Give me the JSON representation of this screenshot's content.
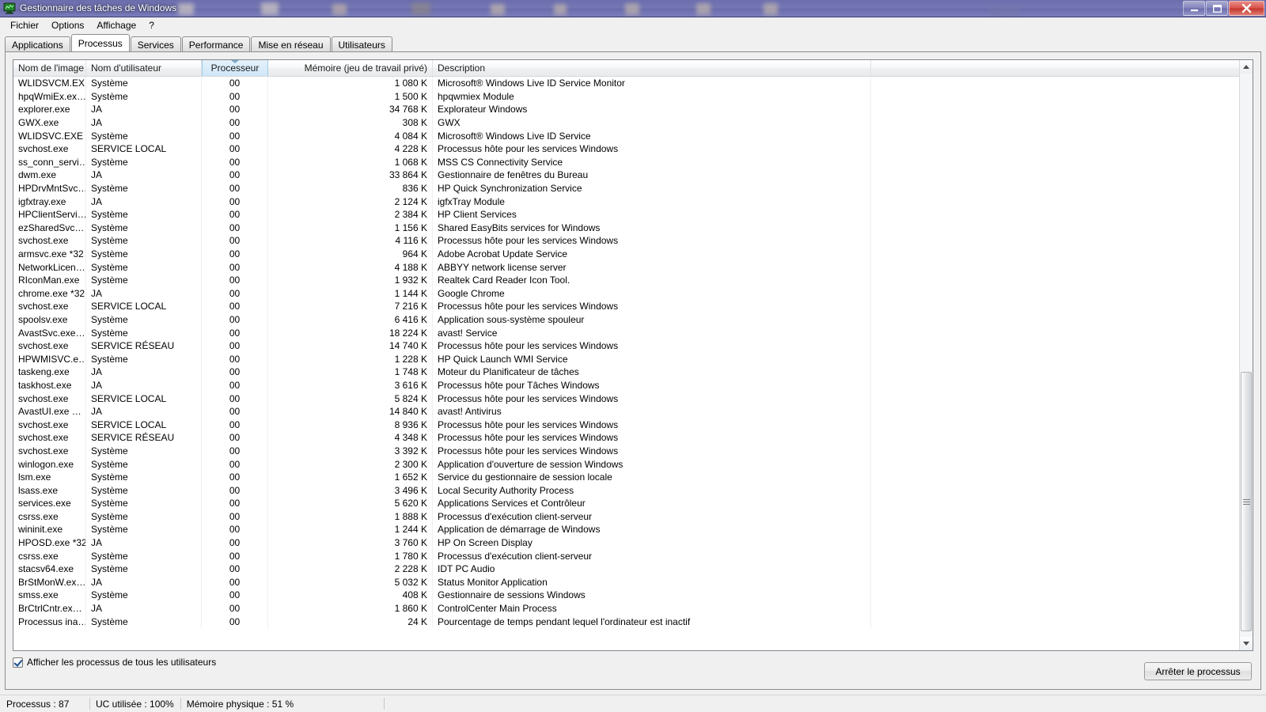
{
  "window": {
    "title": "Gestionnaire des tâches de Windows",
    "icon": "task-manager-icon",
    "controls": {
      "minimize": "—",
      "maximize": "❐",
      "close": "✕"
    }
  },
  "menu": {
    "items": [
      {
        "label": "Fichier"
      },
      {
        "label": "Options"
      },
      {
        "label": "Affichage"
      },
      {
        "label": "?"
      }
    ]
  },
  "tabs": [
    {
      "label": "Applications",
      "active": false
    },
    {
      "label": "Processus",
      "active": true
    },
    {
      "label": "Services",
      "active": false
    },
    {
      "label": "Performance",
      "active": false
    },
    {
      "label": "Mise en réseau",
      "active": false
    },
    {
      "label": "Utilisateurs",
      "active": false
    }
  ],
  "table": {
    "sorted_column": "Processeur",
    "sort_direction": "descending",
    "columns": [
      {
        "key": "name",
        "label": "Nom de l'image",
        "align": "left"
      },
      {
        "key": "user",
        "label": "Nom d'utilisateur",
        "align": "left"
      },
      {
        "key": "cpu",
        "label": "Processeur",
        "align": "center"
      },
      {
        "key": "mem",
        "label": "Mémoire (jeu de travail privé)",
        "align": "right"
      },
      {
        "key": "desc",
        "label": "Description",
        "align": "left"
      }
    ],
    "rows": [
      {
        "name": "WLIDSVCM.EXE",
        "user": "Système",
        "cpu": "00",
        "mem": "1 080 K",
        "desc": "Microsoft® Windows Live ID Service Monitor"
      },
      {
        "name": "hpqWmiEx.ex…",
        "user": "Système",
        "cpu": "00",
        "mem": "1 500 K",
        "desc": "hpqwmiex Module"
      },
      {
        "name": "explorer.exe",
        "user": "JA",
        "cpu": "00",
        "mem": "34 768 K",
        "desc": "Explorateur Windows"
      },
      {
        "name": "GWX.exe",
        "user": "JA",
        "cpu": "00",
        "mem": "308 K",
        "desc": "GWX"
      },
      {
        "name": "WLIDSVC.EXE",
        "user": "Système",
        "cpu": "00",
        "mem": "4 084 K",
        "desc": "Microsoft® Windows Live ID Service"
      },
      {
        "name": "svchost.exe",
        "user": "SERVICE LOCAL",
        "cpu": "00",
        "mem": "4 228 K",
        "desc": "Processus hôte pour les services Windows"
      },
      {
        "name": "ss_conn_servi…",
        "user": "Système",
        "cpu": "00",
        "mem": "1 068 K",
        "desc": "MSS CS Connectivity Service"
      },
      {
        "name": "dwm.exe",
        "user": "JA",
        "cpu": "00",
        "mem": "33 864 K",
        "desc": "Gestionnaire de fenêtres du Bureau"
      },
      {
        "name": "HPDrvMntSvc…",
        "user": "Système",
        "cpu": "00",
        "mem": "836 K",
        "desc": "HP Quick Synchronization Service"
      },
      {
        "name": "igfxtray.exe",
        "user": "JA",
        "cpu": "00",
        "mem": "2 124 K",
        "desc": "igfxTray Module"
      },
      {
        "name": "HPClientServi…",
        "user": "Système",
        "cpu": "00",
        "mem": "2 384 K",
        "desc": "HP Client Services"
      },
      {
        "name": "ezSharedSvc…",
        "user": "Système",
        "cpu": "00",
        "mem": "1 156 K",
        "desc": "Shared EasyBits services for Windows"
      },
      {
        "name": "svchost.exe",
        "user": "Système",
        "cpu": "00",
        "mem": "4 116 K",
        "desc": "Processus hôte pour les services Windows"
      },
      {
        "name": "armsvc.exe *32",
        "user": "Système",
        "cpu": "00",
        "mem": "964 K",
        "desc": "Adobe Acrobat Update Service"
      },
      {
        "name": "NetworkLicen…",
        "user": "Système",
        "cpu": "00",
        "mem": "4 188 K",
        "desc": "ABBYY network license server"
      },
      {
        "name": "RIconMan.exe",
        "user": "Système",
        "cpu": "00",
        "mem": "1 932 K",
        "desc": "Realtek Card Reader Icon Tool."
      },
      {
        "name": "chrome.exe *32",
        "user": "JA",
        "cpu": "00",
        "mem": "1 144 K",
        "desc": "Google Chrome"
      },
      {
        "name": "svchost.exe",
        "user": "SERVICE LOCAL",
        "cpu": "00",
        "mem": "7 216 K",
        "desc": "Processus hôte pour les services Windows"
      },
      {
        "name": "spoolsv.exe",
        "user": "Système",
        "cpu": "00",
        "mem": "6 416 K",
        "desc": "Application sous-système spouleur"
      },
      {
        "name": "AvastSvc.exe…",
        "user": "Système",
        "cpu": "00",
        "mem": "18 224 K",
        "desc": "avast! Service"
      },
      {
        "name": "svchost.exe",
        "user": "SERVICE RÉSEAU",
        "cpu": "00",
        "mem": "14 740 K",
        "desc": "Processus hôte pour les services Windows"
      },
      {
        "name": "HPWMISVC.e…",
        "user": "Système",
        "cpu": "00",
        "mem": "1 228 K",
        "desc": "HP Quick Launch WMI Service"
      },
      {
        "name": "taskeng.exe",
        "user": "JA",
        "cpu": "00",
        "mem": "1 748 K",
        "desc": "Moteur du Planificateur de tâches"
      },
      {
        "name": "taskhost.exe",
        "user": "JA",
        "cpu": "00",
        "mem": "3 616 K",
        "desc": "Processus hôte pour Tâches Windows"
      },
      {
        "name": "svchost.exe",
        "user": "SERVICE LOCAL",
        "cpu": "00",
        "mem": "5 824 K",
        "desc": "Processus hôte pour les services Windows"
      },
      {
        "name": "AvastUI.exe …",
        "user": "JA",
        "cpu": "00",
        "mem": "14 840 K",
        "desc": "avast! Antivirus"
      },
      {
        "name": "svchost.exe",
        "user": "SERVICE LOCAL",
        "cpu": "00",
        "mem": "8 936 K",
        "desc": "Processus hôte pour les services Windows"
      },
      {
        "name": "svchost.exe",
        "user": "SERVICE RÉSEAU",
        "cpu": "00",
        "mem": "4 348 K",
        "desc": "Processus hôte pour les services Windows"
      },
      {
        "name": "svchost.exe",
        "user": "Système",
        "cpu": "00",
        "mem": "3 392 K",
        "desc": "Processus hôte pour les services Windows"
      },
      {
        "name": "winlogon.exe",
        "user": "Système",
        "cpu": "00",
        "mem": "2 300 K",
        "desc": "Application d'ouverture de session Windows"
      },
      {
        "name": "lsm.exe",
        "user": "Système",
        "cpu": "00",
        "mem": "1 652 K",
        "desc": "Service du gestionnaire de session locale"
      },
      {
        "name": "lsass.exe",
        "user": "Système",
        "cpu": "00",
        "mem": "3 496 K",
        "desc": "Local Security Authority Process"
      },
      {
        "name": "services.exe",
        "user": "Système",
        "cpu": "00",
        "mem": "5 620 K",
        "desc": "Applications Services et Contrôleur"
      },
      {
        "name": "csrss.exe",
        "user": "Système",
        "cpu": "00",
        "mem": "1 888 K",
        "desc": "Processus d'exécution client-serveur"
      },
      {
        "name": "wininit.exe",
        "user": "Système",
        "cpu": "00",
        "mem": "1 244 K",
        "desc": "Application de démarrage de Windows"
      },
      {
        "name": "HPOSD.exe *32",
        "user": "JA",
        "cpu": "00",
        "mem": "3 760 K",
        "desc": "HP On Screen Display"
      },
      {
        "name": "csrss.exe",
        "user": "Système",
        "cpu": "00",
        "mem": "1 780 K",
        "desc": "Processus d'exécution client-serveur"
      },
      {
        "name": "stacsv64.exe",
        "user": "Système",
        "cpu": "00",
        "mem": "2 228 K",
        "desc": "IDT PC Audio"
      },
      {
        "name": "BrStMonW.ex…",
        "user": "JA",
        "cpu": "00",
        "mem": "5 032 K",
        "desc": "Status Monitor Application"
      },
      {
        "name": "smss.exe",
        "user": "Système",
        "cpu": "00",
        "mem": "408 K",
        "desc": "Gestionnaire de sessions Windows"
      },
      {
        "name": "BrCtrlCntr.ex…",
        "user": "JA",
        "cpu": "00",
        "mem": "1 860 K",
        "desc": "ControlCenter Main Process"
      },
      {
        "name": "Processus ina…",
        "user": "Système",
        "cpu": "00",
        "mem": "24 K",
        "desc": "Pourcentage de temps pendant lequel l'ordinateur est inactif"
      }
    ]
  },
  "footer": {
    "show_all_users_label": "Afficher les processus de tous les utilisateurs",
    "show_all_users_checked": true,
    "end_process_label": "Arrêter le processus"
  },
  "statusbar": {
    "processes": "Processus : 87",
    "cpu_usage": "UC utilisée : 100%",
    "physical_memory": "Mémoire physique : 51 %",
    "extra": ""
  },
  "colors": {
    "titlebar": "#7577b5",
    "close_button": "#c3362d",
    "sorted_header": "#d8ebf9",
    "panel_bg": "#f0f0f0"
  }
}
